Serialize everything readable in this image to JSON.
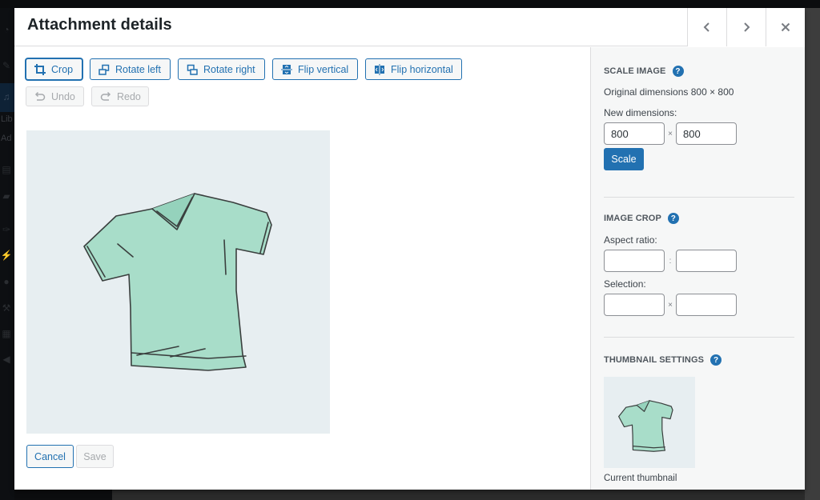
{
  "modal": {
    "title": "Attachment details",
    "nav": {
      "previous_label": "Previous",
      "next_label": "Next",
      "close_label": "Close"
    }
  },
  "toolbar": {
    "crop": "Crop",
    "rotate_left": "Rotate left",
    "rotate_right": "Rotate right",
    "flip_vertical": "Flip vertical",
    "flip_horizontal": "Flip horizontal",
    "undo": "Undo",
    "redo": "Redo"
  },
  "image": {
    "subject": "Mint green v-neck t-shirt illustration"
  },
  "footer": {
    "cancel": "Cancel",
    "save": "Save"
  },
  "scale_image": {
    "title": "Scale Image",
    "original_dimensions": "Original dimensions 800 × 800",
    "new_dimensions_label": "New dimensions:",
    "width_value": "800",
    "height_value": "800",
    "separator": "×",
    "scale_button": "Scale"
  },
  "image_crop": {
    "title": "Image Crop",
    "aspect_ratio_label": "Aspect ratio:",
    "aspect_width_value": "",
    "aspect_height_value": "",
    "aspect_separator": ":",
    "selection_label": "Selection:",
    "selection_width_value": "",
    "selection_height_value": "",
    "selection_separator": "×"
  },
  "thumbnail_settings": {
    "title": "Thumbnail Settings",
    "caption": "Current thumbnail"
  },
  "help_glyph": "?",
  "colors": {
    "accent": "#2271b1",
    "shirt": "#a8ddc9",
    "image_bg": "#e7eef1"
  },
  "background": {
    "sidebar_fragments": [
      "Lib",
      "Ad"
    ]
  }
}
